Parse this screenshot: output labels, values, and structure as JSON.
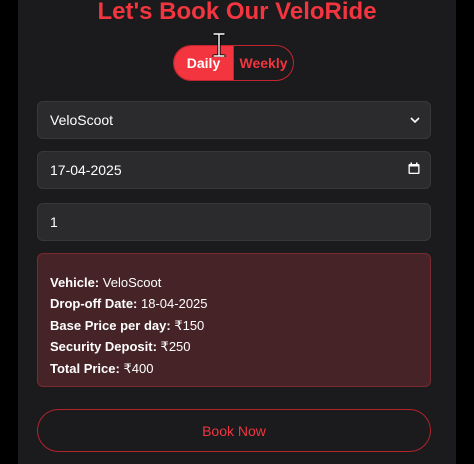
{
  "page": {
    "title": "Let's Book Our VeloRide"
  },
  "toggle": {
    "daily_label": "Daily",
    "weekly_label": "Weekly",
    "selected": "Daily"
  },
  "form": {
    "vehicle_value": "VeloScoot",
    "date_value": "17-04-2025",
    "quantity_value": "1"
  },
  "summary": {
    "vehicle_label": "Vehicle:",
    "vehicle_value": "VeloScoot",
    "dropoff_label": "Drop-off Date:",
    "dropoff_value": "18-04-2025",
    "base_price_label": "Base Price per day:",
    "base_price_value": "₹150",
    "deposit_label": "Security Deposit:",
    "deposit_value": "₹250",
    "total_label": "Total Price:",
    "total_value": "₹400"
  },
  "actions": {
    "book_label": "Book Now"
  },
  "colors": {
    "accent": "#f2353f",
    "card_bg": "#1b1a1c",
    "summary_bg": "#462327"
  }
}
